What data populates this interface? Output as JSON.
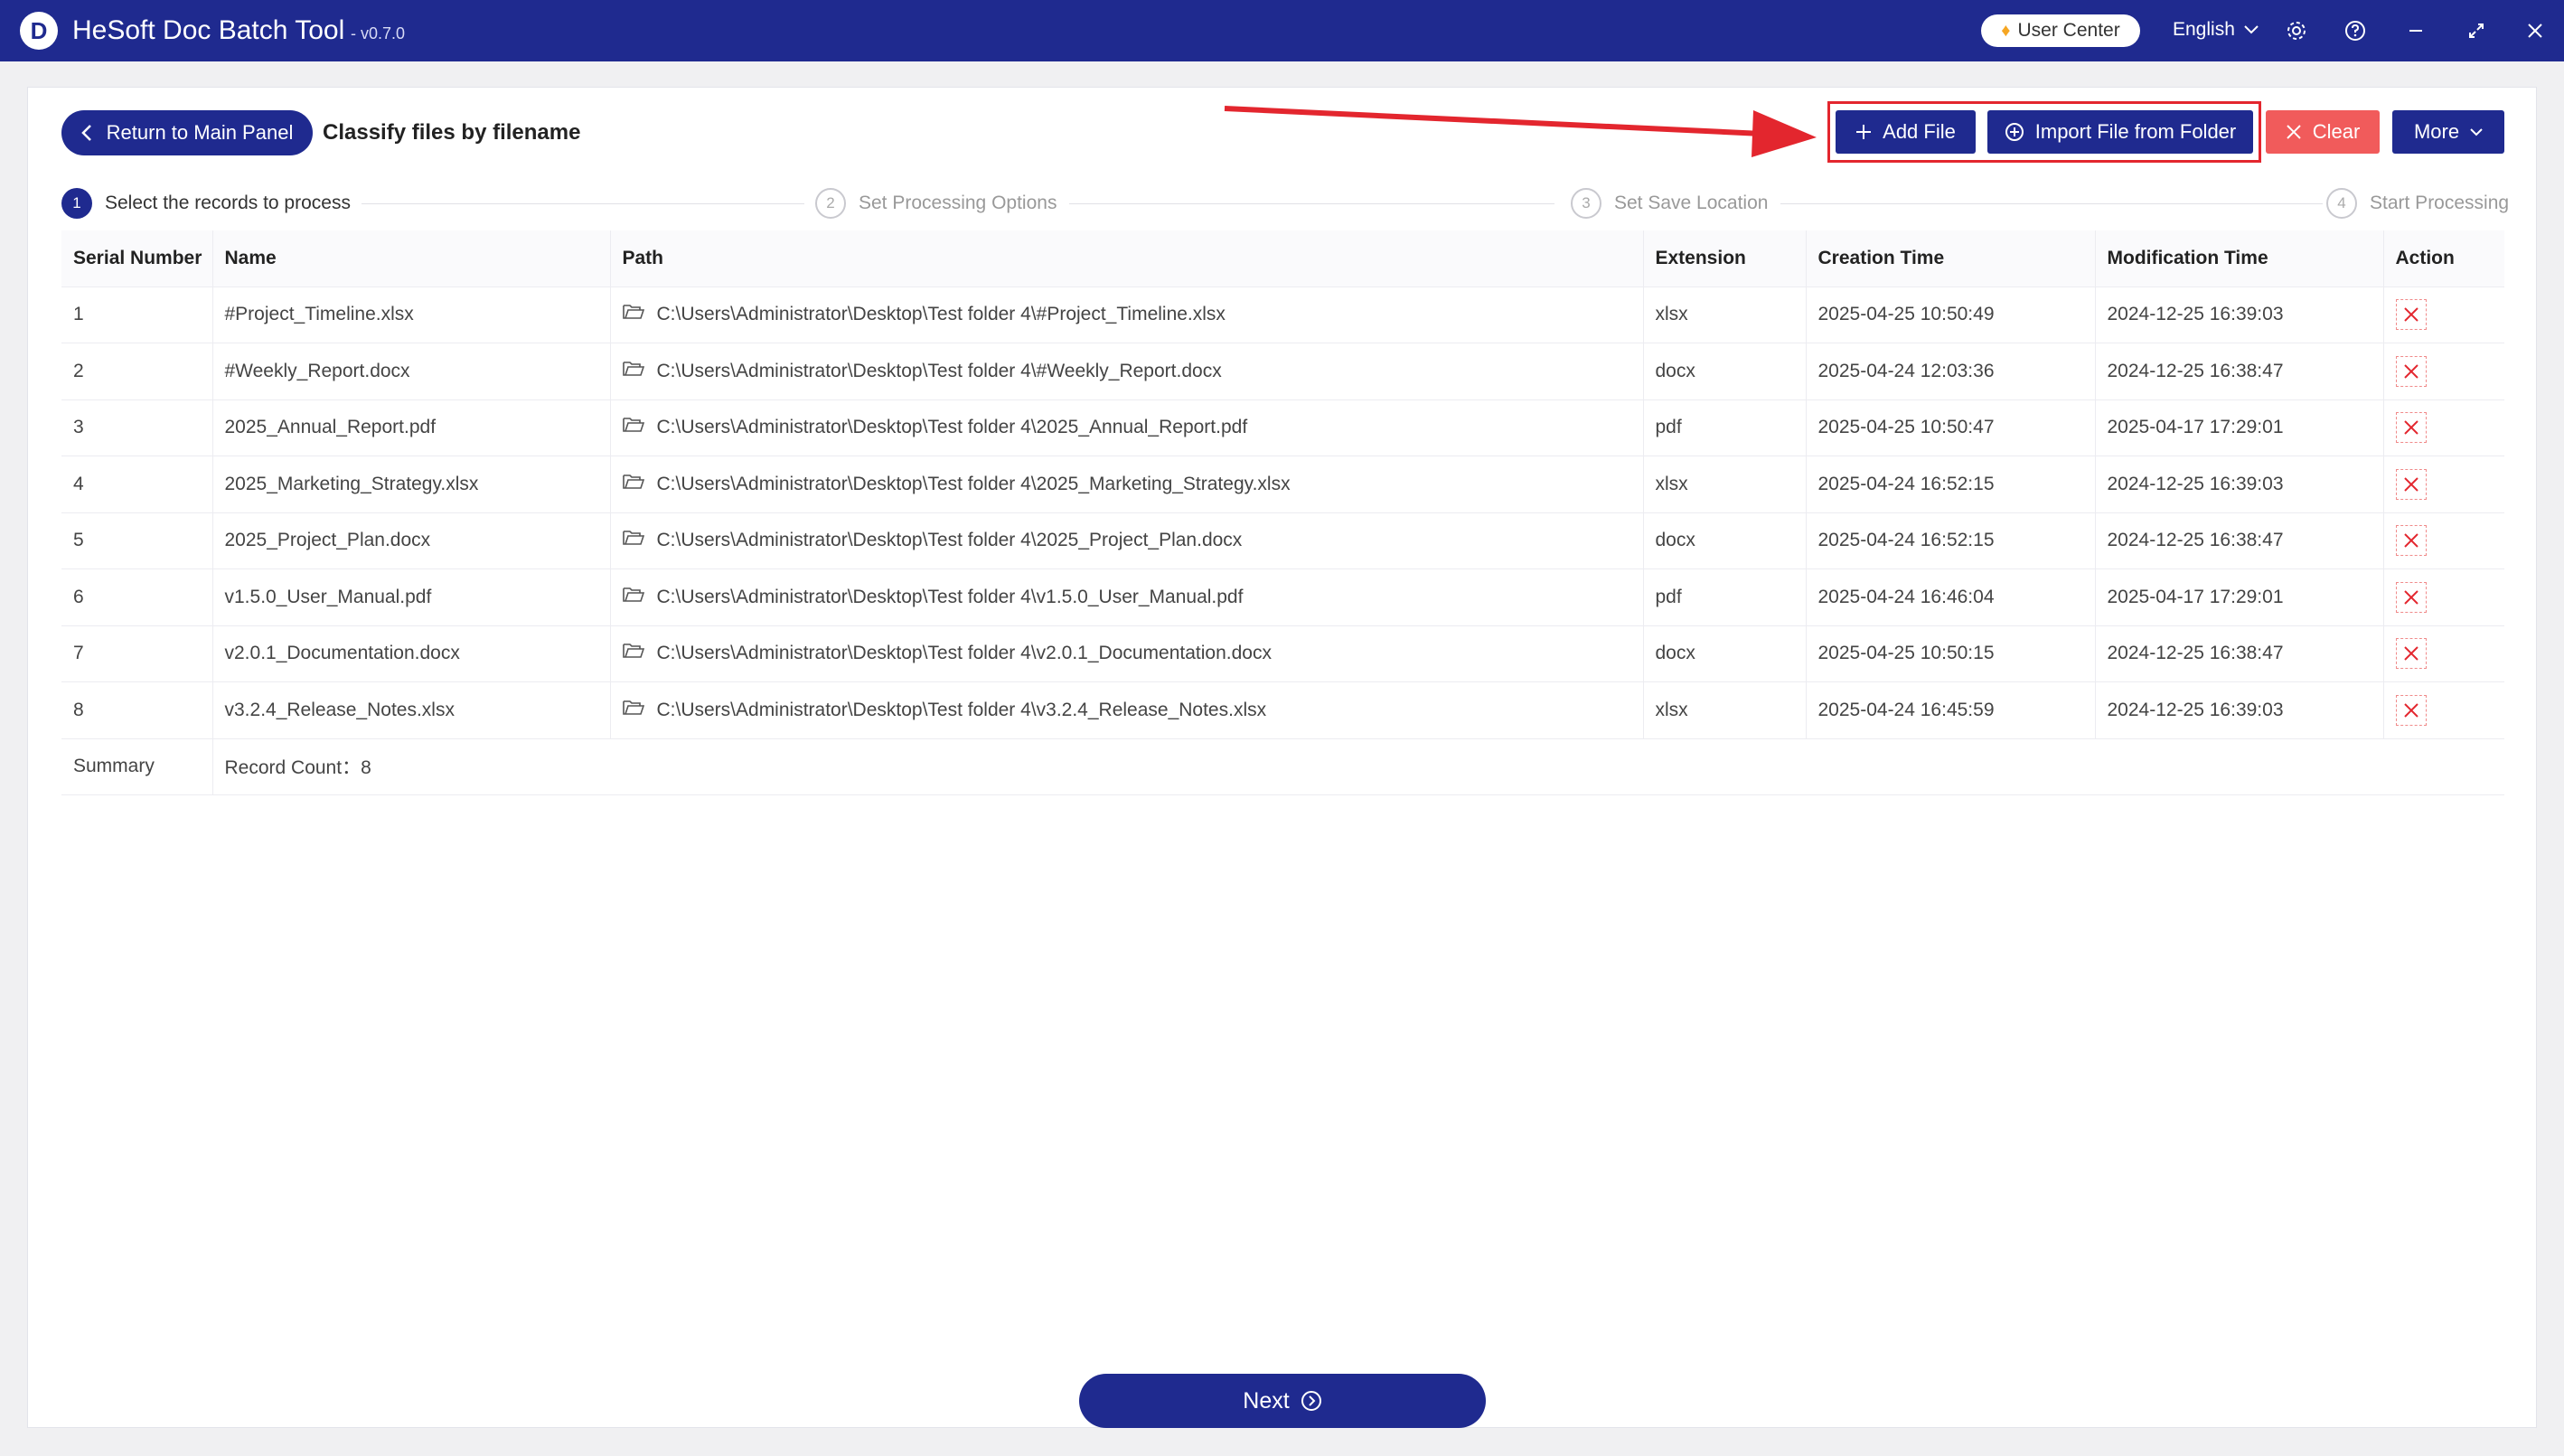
{
  "titlebar": {
    "app_name": "HeSoft Doc Batch Tool",
    "version": "- v0.7.0",
    "user_center": "User Center",
    "language": "English"
  },
  "toolbar": {
    "back_label": "Return to Main Panel",
    "page_title": "Classify files by filename",
    "add_file": "Add File",
    "import_folder": "Import File from Folder",
    "clear": "Clear",
    "more": "More"
  },
  "steps": [
    {
      "num": "1",
      "label": "Select the records to process",
      "active": true
    },
    {
      "num": "2",
      "label": "Set Processing Options",
      "active": false
    },
    {
      "num": "3",
      "label": "Set Save Location",
      "active": false
    },
    {
      "num": "4",
      "label": "Start Processing",
      "active": false
    }
  ],
  "table": {
    "columns": [
      "Serial Number",
      "Name",
      "Path",
      "Extension",
      "Creation Time",
      "Modification Time",
      "Action"
    ],
    "rows": [
      {
        "serial": "1",
        "name": "#Project_Timeline.xlsx",
        "path": "C:\\Users\\Administrator\\Desktop\\Test folder 4\\#Project_Timeline.xlsx",
        "ext": "xlsx",
        "created": "2025-04-25 10:50:49",
        "modified": "2024-12-25 16:39:03"
      },
      {
        "serial": "2",
        "name": "#Weekly_Report.docx",
        "path": "C:\\Users\\Administrator\\Desktop\\Test folder 4\\#Weekly_Report.docx",
        "ext": "docx",
        "created": "2025-04-24 12:03:36",
        "modified": "2024-12-25 16:38:47"
      },
      {
        "serial": "3",
        "name": "2025_Annual_Report.pdf",
        "path": "C:\\Users\\Administrator\\Desktop\\Test folder 4\\2025_Annual_Report.pdf",
        "ext": "pdf",
        "created": "2025-04-25 10:50:47",
        "modified": "2025-04-17 17:29:01"
      },
      {
        "serial": "4",
        "name": "2025_Marketing_Strategy.xlsx",
        "path": "C:\\Users\\Administrator\\Desktop\\Test folder 4\\2025_Marketing_Strategy.xlsx",
        "ext": "xlsx",
        "created": "2025-04-24 16:52:15",
        "modified": "2024-12-25 16:39:03"
      },
      {
        "serial": "5",
        "name": "2025_Project_Plan.docx",
        "path": "C:\\Users\\Administrator\\Desktop\\Test folder 4\\2025_Project_Plan.docx",
        "ext": "docx",
        "created": "2025-04-24 16:52:15",
        "modified": "2024-12-25 16:38:47"
      },
      {
        "serial": "6",
        "name": "v1.5.0_User_Manual.pdf",
        "path": "C:\\Users\\Administrator\\Desktop\\Test folder 4\\v1.5.0_User_Manual.pdf",
        "ext": "pdf",
        "created": "2025-04-24 16:46:04",
        "modified": "2025-04-17 17:29:01"
      },
      {
        "serial": "7",
        "name": "v2.0.1_Documentation.docx",
        "path": "C:\\Users\\Administrator\\Desktop\\Test folder 4\\v2.0.1_Documentation.docx",
        "ext": "docx",
        "created": "2025-04-25 10:50:15",
        "modified": "2024-12-25 16:38:47"
      },
      {
        "serial": "8",
        "name": "v3.2.4_Release_Notes.xlsx",
        "path": "C:\\Users\\Administrator\\Desktop\\Test folder 4\\v3.2.4_Release_Notes.xlsx",
        "ext": "xlsx",
        "created": "2025-04-24 16:45:59",
        "modified": "2024-12-25 16:39:03"
      }
    ],
    "summary_label": "Summary",
    "record_count": "Record Count：8"
  },
  "footer": {
    "next_label": "Next"
  },
  "colors": {
    "primary": "#1f2a8f",
    "danger": "#f15b5b",
    "annotation": "#e3262e"
  }
}
